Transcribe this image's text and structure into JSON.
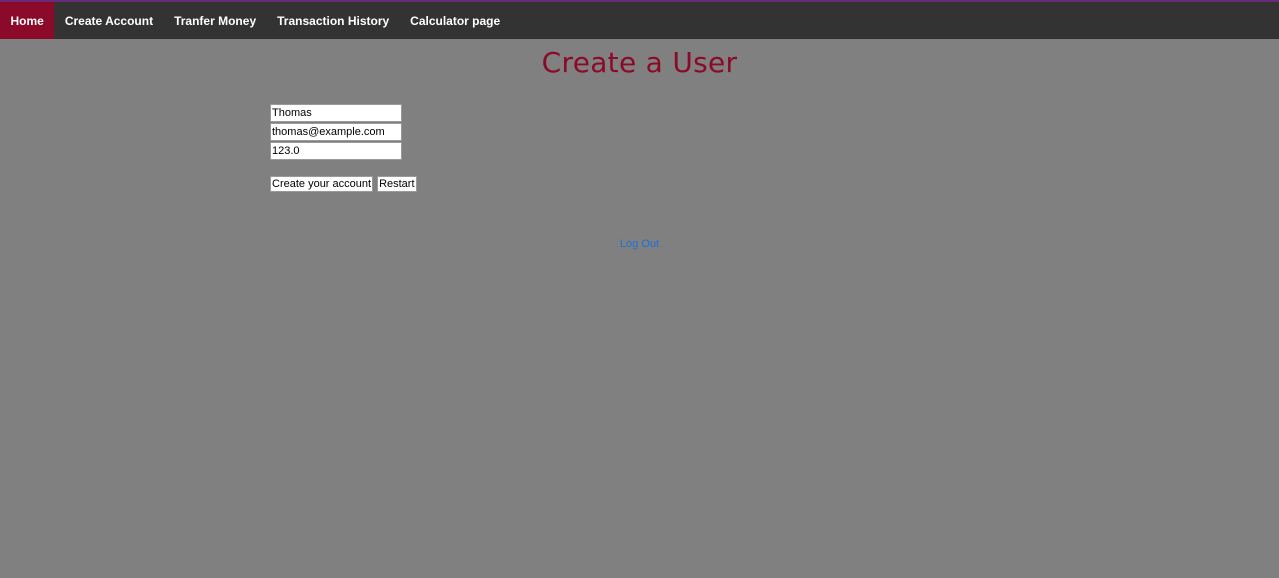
{
  "nav": {
    "items": [
      {
        "label": "Home",
        "active": true
      },
      {
        "label": "Create Account",
        "active": false
      },
      {
        "label": "Tranfer Money",
        "active": false
      },
      {
        "label": "Transaction History",
        "active": false
      },
      {
        "label": "Calculator page",
        "active": false
      }
    ]
  },
  "page": {
    "title": "Create a User"
  },
  "form": {
    "name_value": "Thomas",
    "email_value": "thomas@example.com",
    "amount_value": "123.0",
    "create_label": "Create your account",
    "restart_label": "Restart"
  },
  "footer": {
    "logout_label": "Log Out"
  },
  "colors": {
    "background": "#808080",
    "navbar": "#333333",
    "accent": "#8b0a2a",
    "link": "#1e6fd9"
  }
}
